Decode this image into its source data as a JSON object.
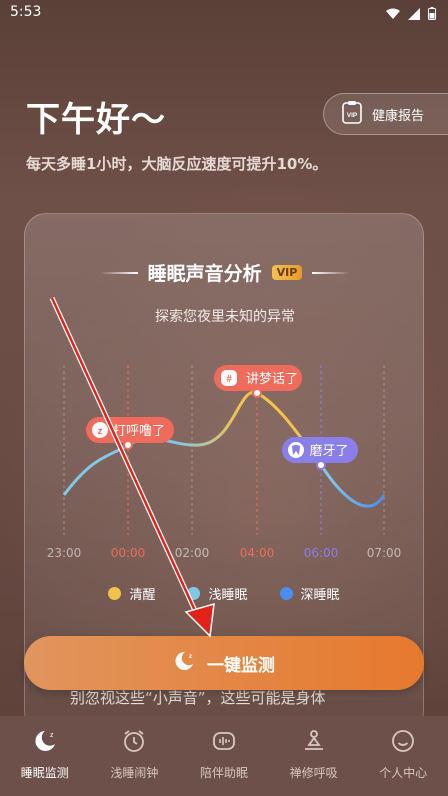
{
  "status": {
    "time": "5:53"
  },
  "greeting": "下午好～",
  "subtitle": "每天多睡1小时，大脑反应速度可提升10%。",
  "report_button": {
    "label": "健康报告"
  },
  "card": {
    "title": "睡眠声音分析",
    "vip": "VIP",
    "subtitle": "探索您夜里未知的异常",
    "bubbles": [
      {
        "label": "打呼噜了",
        "time": "00:00"
      },
      {
        "label": "讲梦话了",
        "time": "04:00"
      },
      {
        "label": "磨牙了",
        "time": "06:00"
      }
    ],
    "highlight_prefix": "Zz"
  },
  "chart_data": {
    "type": "line",
    "categories": [
      "23:00",
      "00:00",
      "02:00",
      "04:00",
      "06:00",
      "07:00"
    ]
  },
  "legend": [
    {
      "label": "清醒",
      "color": "#f2c34a"
    },
    {
      "label": "浅睡眠",
      "color": "#7fc8e6"
    },
    {
      "label": "深睡眠",
      "color": "#4a8ff0"
    }
  ],
  "cta": {
    "label": "一键监测"
  },
  "peek_text": "别忽视这些“小声音”，这些可能是身体\n在悄悄发出的健康警报，如呼吸暂停、焦",
  "tabs": [
    {
      "label": "睡眠监测"
    },
    {
      "label": "浅睡闹钟"
    },
    {
      "label": "陪伴助眠"
    },
    {
      "label": "禅修呼吸"
    },
    {
      "label": "个人中心"
    }
  ]
}
